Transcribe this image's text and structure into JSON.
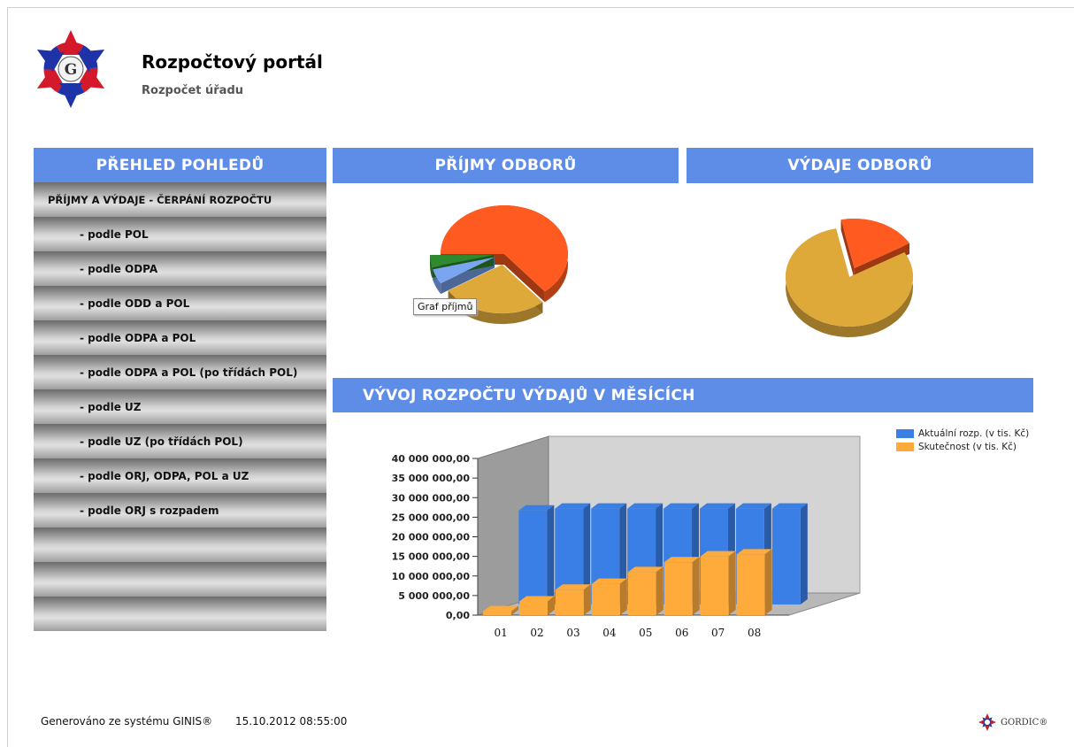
{
  "header": {
    "title": "Rozpočtový portál",
    "subtitle": "Rozpočet úřadu"
  },
  "menu": {
    "heading": "PŘEHLED POHLEDŮ",
    "items": [
      {
        "label": "PŘÍJMY A VÝDAJE - ČERPÁNÍ ROZPOČTU"
      },
      {
        "label": "- podle POL"
      },
      {
        "label": "- podle ODPA"
      },
      {
        "label": "- podle ODD a POL"
      },
      {
        "label": "- podle ODPA a POL"
      },
      {
        "label": "- podle ODPA a POL (po třídách POL)"
      },
      {
        "label": "- podle UZ"
      },
      {
        "label": "- podle UZ (po třídách POL)"
      },
      {
        "label": "- podle ORJ, ODPA, POL a UZ"
      },
      {
        "label": "- podle ORJ s rozpadem"
      },
      {
        "label": ""
      },
      {
        "label": ""
      },
      {
        "label": ""
      }
    ]
  },
  "income_panel": {
    "heading": "PŘÍJMY ODBORŮ",
    "tooltip": "Graf příjmů"
  },
  "expense_panel": {
    "heading": "VÝDAJE ODBORŮ"
  },
  "trend_panel": {
    "heading": "VÝVOJ ROZPOČTU VÝDAJŮ V MĚSÍCÍCH"
  },
  "footer": {
    "generated": "Generováno ze systému GINIS®",
    "timestamp": "15.10.2012 08:55:00",
    "brand": "GORDIC®"
  },
  "colors": {
    "accent": "#5e8de8",
    "pie_red": "#ff5a1f",
    "pie_gold": "#dfa93a",
    "pie_blue": "#7aa6f0",
    "pie_green": "#2e8a2e",
    "bar_blue": "#3a7fe6",
    "bar_orange": "#ffab3c"
  },
  "chart_data": [
    {
      "type": "pie",
      "title": "",
      "slices": [
        {
          "value": 64,
          "color": "#ff5a1f"
        },
        {
          "value": 27,
          "color": "#dfa93a"
        },
        {
          "value": 5,
          "color": "#7aa6f0"
        },
        {
          "value": 4,
          "color": "#2e8a2e"
        }
      ]
    },
    {
      "type": "pie",
      "title": "",
      "slices": [
        {
          "value": 80,
          "color": "#dfa93a"
        },
        {
          "value": 20,
          "color": "#ff5a1f"
        }
      ]
    },
    {
      "type": "bar",
      "title": "",
      "categories": [
        "01",
        "02",
        "03",
        "04",
        "05",
        "06",
        "07",
        "08"
      ],
      "series": [
        {
          "name": "Aktuální rozp. (v tis. Kč)",
          "color": "#3a7fe6",
          "values": [
            24000000,
            24500000,
            24500000,
            24500000,
            24500000,
            24500000,
            24500000,
            24500000
          ]
        },
        {
          "name": "Skutečnost (v tis. Kč)",
          "color": "#ffab3c",
          "values": [
            1000000,
            3500000,
            6500000,
            8000000,
            11000000,
            13500000,
            15000000,
            15500000
          ]
        }
      ],
      "yticks": [
        "0,00",
        "5 000 000,00",
        "10 000 000,00",
        "15 000 000,00",
        "20 000 000,00",
        "25 000 000,00",
        "30 000 000,00",
        "35 000 000,00",
        "40 000 000,00"
      ],
      "ylim": [
        0,
        40000000
      ],
      "legend": "top-right"
    }
  ]
}
